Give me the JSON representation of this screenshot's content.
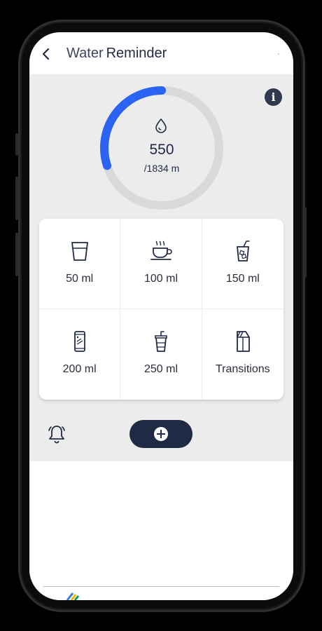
{
  "header": {
    "title_part1": "Water",
    "title_part2": "Reminder"
  },
  "progress": {
    "consumed": "550",
    "goal": "/1834 m",
    "fraction": 0.3,
    "color": "#2b63f5",
    "track_color": "#d9d9d9"
  },
  "options": [
    {
      "label": "50 ml",
      "icon": "glass-icon"
    },
    {
      "label": "100 ml",
      "icon": "coffee-cup-icon"
    },
    {
      "label": "150 ml",
      "icon": "iced-drink-icon"
    },
    {
      "label": "200 ml",
      "icon": "can-icon"
    },
    {
      "label": "250 ml",
      "icon": "takeaway-cup-icon"
    },
    {
      "label": "Transitions",
      "icon": "milk-carton-icon"
    }
  ],
  "colors": {
    "primary_dark": "#1f2a44",
    "background": "#ececec"
  }
}
